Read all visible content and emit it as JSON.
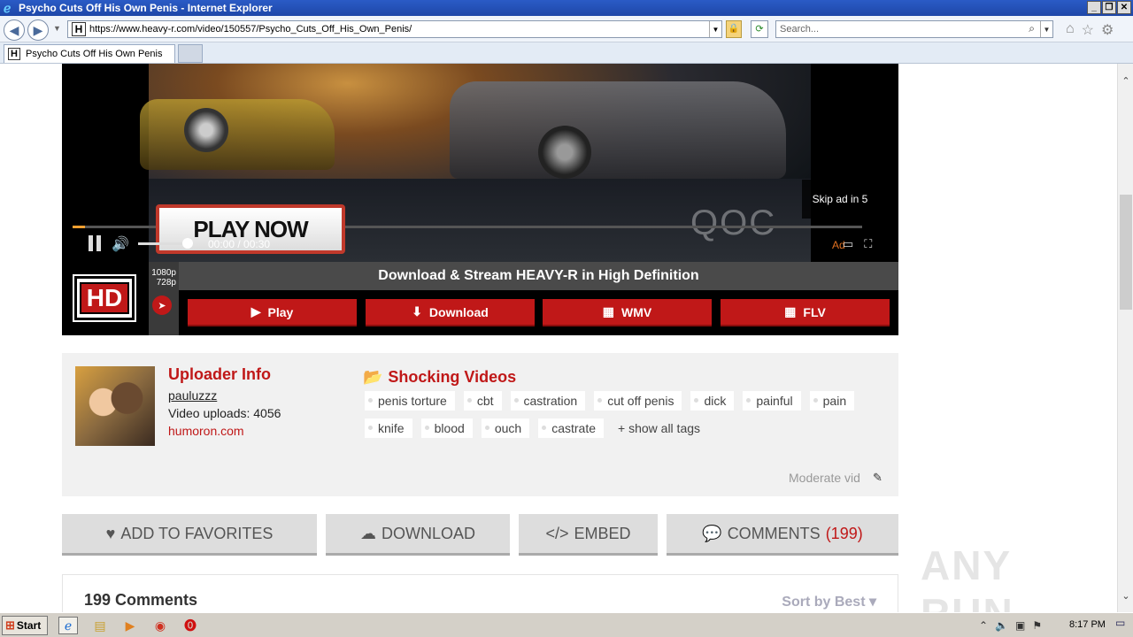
{
  "window": {
    "title": "Psycho Cuts Off His Own Penis - Internet Explorer",
    "controls": [
      "_",
      "❐",
      "✕"
    ]
  },
  "browser": {
    "url": "https://www.heavy-r.com/video/150557/Psycho_Cuts_Off_His_Own_Penis/",
    "search_placeholder": "Search...",
    "tab_title": "Psycho Cuts Off His Own Penis",
    "favicon": "H"
  },
  "player": {
    "play_now": "PLAY NOW",
    "time": "00:00 / 00:30",
    "skip_ad": "Skip ad in 5",
    "ad_label": "Ad",
    "watermark": "QOC",
    "progress_fraction": 0.016
  },
  "download_bar": {
    "hd_badge": "HD",
    "res_1": "1080p",
    "res_2": "728p",
    "banner": "Download & Stream HEAVY-R in High Definition",
    "buttons": [
      {
        "icon": "▶",
        "label": "Play"
      },
      {
        "icon": "⬇",
        "label": "Download"
      },
      {
        "icon": "▦",
        "label": "WMV"
      },
      {
        "icon": "▦",
        "label": "FLV"
      }
    ]
  },
  "uploader": {
    "title": "Uploader Info",
    "name": "pauluzzz",
    "uploads": "Video uploads: 4056",
    "site": "humoron.com"
  },
  "category": {
    "title": "Shocking Videos",
    "tags": [
      "penis torture",
      "cbt",
      "castration",
      "cut off penis",
      "dick",
      "painful",
      "pain",
      "knife",
      "blood",
      "ouch",
      "castrate"
    ],
    "show_all": "+ show all tags",
    "moderate": "Moderate vid"
  },
  "actions": {
    "favorites": "ADD TO FAVORITES",
    "download": "DOWNLOAD",
    "embed": "EMBED",
    "comments": "COMMENTS",
    "comments_count": "(199)"
  },
  "comments": {
    "title": "199 Comments",
    "sort": "Sort by Best ▾"
  },
  "overlay": {
    "watermark": "ANY RUN"
  },
  "taskbar": {
    "start": "Start",
    "clock": "8:17 PM"
  }
}
